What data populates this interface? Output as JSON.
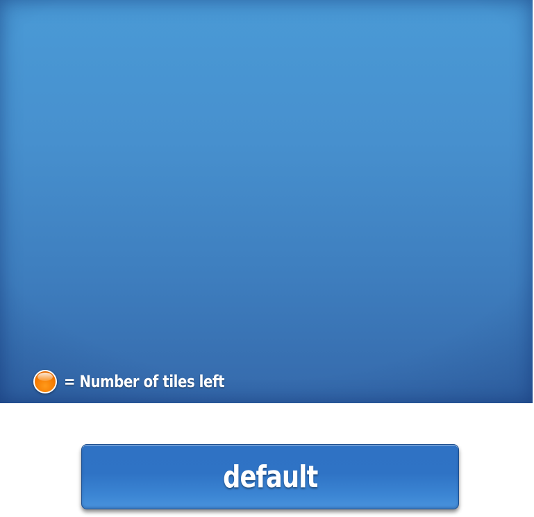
{
  "legend": {
    "icon": "orange-circle-icon",
    "text": "= Number of tiles left"
  },
  "button": {
    "label": "default"
  },
  "colors": {
    "board_top": "#4a9ad6",
    "board_bottom": "#3569ab",
    "legend_dot": "#f57a00",
    "button": "#2f72c4",
    "text": "#ffffff"
  }
}
